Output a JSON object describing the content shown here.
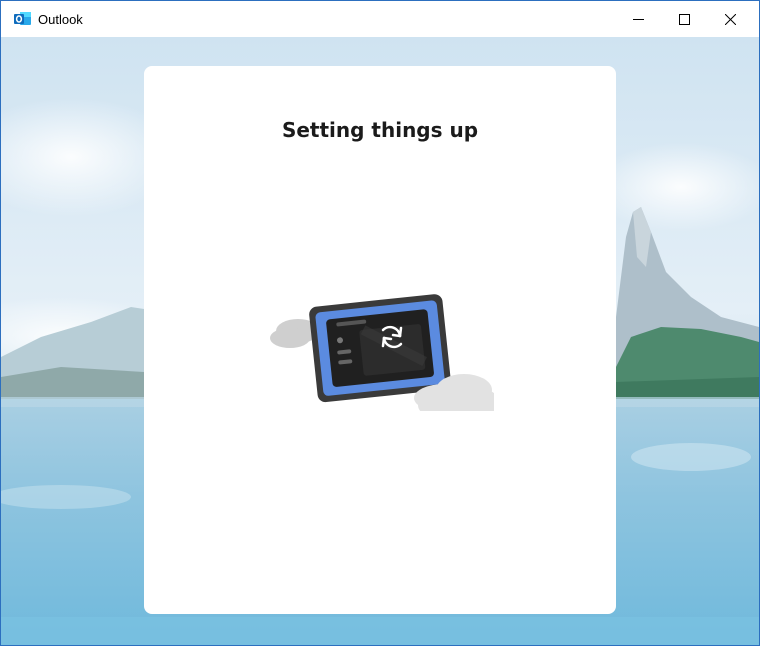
{
  "window": {
    "title": "Outlook",
    "app_icon": "outlook-icon",
    "controls": {
      "minimize": "minimize-icon",
      "maximize": "maximize-icon",
      "close": "close-icon"
    }
  },
  "card": {
    "title": "Setting things up",
    "illustration_icon": "device-sync-illustration"
  },
  "colors": {
    "accent": "#0f6cbd",
    "device_blue": "#5b8be0",
    "card_bg": "#ffffff"
  }
}
